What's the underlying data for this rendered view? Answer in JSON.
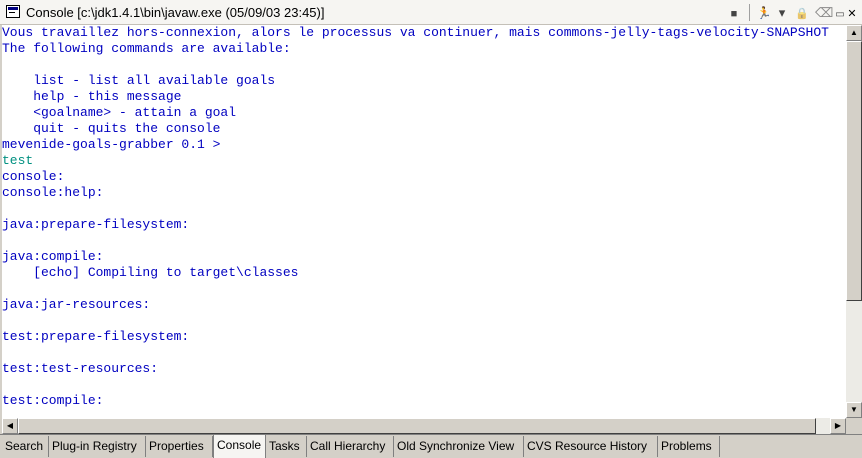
{
  "window": {
    "title": "Console [c:\\jdk1.4.1\\bin\\javaw.exe (05/09/03 23:45)]",
    "toolbar": [
      {
        "name": "terminate-icon",
        "glyph": "■"
      },
      {
        "name": "show-console-icon",
        "glyph": "🏃"
      },
      {
        "name": "dropdown-arrow-icon",
        "glyph": "▾"
      },
      {
        "name": "scroll-lock-icon",
        "glyph": "🔒"
      },
      {
        "name": "clear-console-icon",
        "glyph": "⌫"
      },
      {
        "name": "minimize-view-icon",
        "glyph": "▭"
      },
      {
        "name": "close-icon",
        "glyph": "✕"
      }
    ]
  },
  "console": {
    "lines": [
      {
        "text": "Vous travaillez hors-connexion, alors le processus va continuer, mais commons-jelly-tags-velocity-SNAPSHOT",
        "kind": "output"
      },
      {
        "text": "The following commands are available:",
        "kind": "output"
      },
      {
        "text": "",
        "kind": "output"
      },
      {
        "text": "    list - list all available goals",
        "kind": "output"
      },
      {
        "text": "    help - this message",
        "kind": "output"
      },
      {
        "text": "    <goalname> - attain a goal",
        "kind": "output"
      },
      {
        "text": "    quit - quits the console",
        "kind": "output"
      },
      {
        "text": "mevenide-goals-grabber 0.1 >",
        "kind": "output"
      },
      {
        "text": "test",
        "kind": "input"
      },
      {
        "text": "console:",
        "kind": "output"
      },
      {
        "text": "console:help:",
        "kind": "output"
      },
      {
        "text": "",
        "kind": "output"
      },
      {
        "text": "java:prepare-filesystem:",
        "kind": "output"
      },
      {
        "text": "",
        "kind": "output"
      },
      {
        "text": "java:compile:",
        "kind": "output"
      },
      {
        "text": "    [echo] Compiling to target\\classes",
        "kind": "output"
      },
      {
        "text": "",
        "kind": "output"
      },
      {
        "text": "java:jar-resources:",
        "kind": "output"
      },
      {
        "text": "",
        "kind": "output"
      },
      {
        "text": "test:prepare-filesystem:",
        "kind": "output"
      },
      {
        "text": "",
        "kind": "output"
      },
      {
        "text": "test:test-resources:",
        "kind": "output"
      },
      {
        "text": "",
        "kind": "output"
      },
      {
        "text": "test:compile:",
        "kind": "output"
      }
    ]
  },
  "tabs": [
    {
      "label": "Search",
      "active": false
    },
    {
      "label": "Plug-in Registry",
      "active": false
    },
    {
      "label": "Properties",
      "active": false
    },
    {
      "label": "Console",
      "active": true
    },
    {
      "label": "Tasks",
      "active": false
    },
    {
      "label": "Call Hierarchy",
      "active": false
    },
    {
      "label": "Old Synchronize View",
      "active": false
    },
    {
      "label": "CVS Resource History",
      "active": false
    },
    {
      "label": "Problems",
      "active": false
    }
  ],
  "colors": {
    "output_text": "#0000c0",
    "input_text": "#009080",
    "active_tab": "#f6f5f2",
    "title_bar": "#f6f5f2"
  }
}
